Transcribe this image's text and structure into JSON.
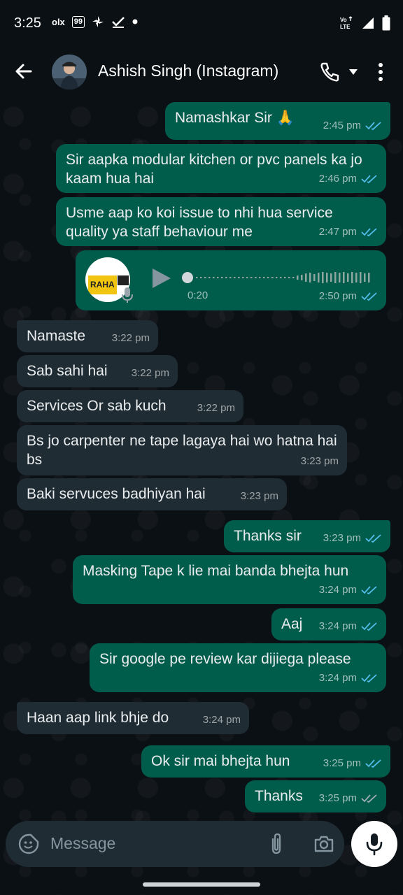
{
  "status_bar": {
    "time": "3:25",
    "badge_99": "99",
    "olx": "olx",
    "volte": "Vo\nLTE"
  },
  "header": {
    "contact_name": "Ashish Singh (Instagram)",
    "icons": [
      "back-arrow-icon",
      "voice-call-icon",
      "caret-down-icon",
      "more-vert-icon"
    ]
  },
  "messages": [
    {
      "dir": "out",
      "text": "Namashkar Sir 🙏",
      "time": "2:45 pm",
      "read": true
    },
    {
      "dir": "out",
      "text": "Sir aapka modular kitchen or pvc panels ka jo kaam hua hai",
      "time": "2:46 pm",
      "read": true
    },
    {
      "dir": "out",
      "text": "Usme aap ko koi issue to nhi hua service quality ya staff behaviour me",
      "time": "2:47 pm",
      "read": true
    },
    {
      "dir": "out",
      "type": "voice",
      "thumb_text": "RAHA",
      "duration": "0:20",
      "time": "2:50 pm",
      "read": true
    },
    {
      "dir": "in",
      "text": "Namaste",
      "time": "3:22 pm"
    },
    {
      "dir": "in",
      "text": "Sab sahi hai",
      "time": "3:22 pm"
    },
    {
      "dir": "in",
      "text": "Services Or sab kuch",
      "time": "3:22 pm"
    },
    {
      "dir": "in",
      "text": "Bs jo carpenter ne tape lagaya hai wo hatna hai bs",
      "time": "3:23 pm"
    },
    {
      "dir": "in",
      "text": "Baki servuces badhiyan hai",
      "time": "3:23 pm"
    },
    {
      "dir": "out",
      "text": "Thanks sir",
      "time": "3:23 pm",
      "read": true
    },
    {
      "dir": "out",
      "text": "Masking Tape k lie mai banda bhejta hun",
      "time": "3:24 pm",
      "read": true
    },
    {
      "dir": "out",
      "text": "Aaj",
      "time": "3:24 pm",
      "read": true
    },
    {
      "dir": "out",
      "text": "Sir google pe review kar dijiega please",
      "time": "3:24 pm",
      "read": true
    },
    {
      "dir": "in",
      "text": "Haan aap link bhje do",
      "time": "3:24 pm"
    },
    {
      "dir": "out",
      "text": "Ok sir mai bhejta hun",
      "time": "3:25 pm",
      "read": true
    },
    {
      "dir": "out",
      "text": "Thanks",
      "time": "3:25 pm",
      "read": false
    }
  ],
  "composer": {
    "placeholder": "Message",
    "icons": [
      "emoji-sticker-icon",
      "attach-icon",
      "camera-icon",
      "mic-icon"
    ]
  },
  "colors": {
    "outgoing_bubble": "#005c4b",
    "incoming_bubble": "#202c33",
    "background": "#0b1014",
    "read_tick": "#53bdeb"
  }
}
